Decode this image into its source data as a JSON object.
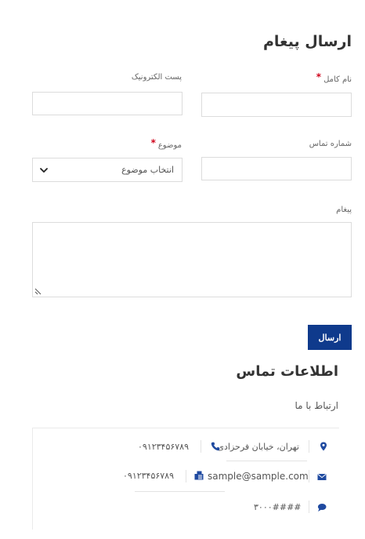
{
  "form": {
    "title": "ارسال پیغام",
    "full_name_label": "نام کامل",
    "email_label": "پست الکترونیک",
    "phone_label": "شماره تماس",
    "subject_label": "موضوع",
    "subject_selected": "انتخاب موضوع",
    "message_label": "پیغام",
    "required_mark": "*",
    "submit_label": "ارسال"
  },
  "contact": {
    "title": "اطلاعات تماس",
    "subtitle": "ارتباط با ما",
    "address": "تهران، خیابان فرحزادی",
    "phone": "۰۹۱۲۳۴۵۶۷۸۹",
    "email": "sample@sample.com",
    "fax": "۰۹۱۲۳۴۵۶۷۸۹",
    "sms": "۳۰۰۰####"
  },
  "colors": {
    "accent": "#0f3a8c",
    "required": "#d0021b"
  },
  "icons": {
    "address": "map-marker-icon",
    "phone": "phone-icon",
    "email": "envelope-icon",
    "fax": "fax-icon",
    "sms": "chat-bubble-icon",
    "select": "chevron-down-icon"
  }
}
